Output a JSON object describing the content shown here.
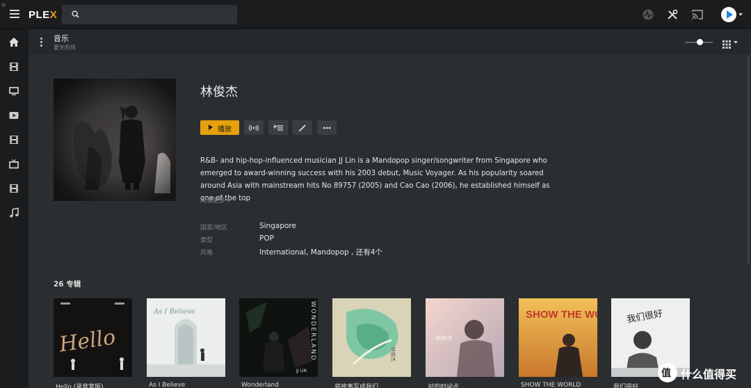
{
  "app": {
    "logo_main": "PLE",
    "logo_accent": "X"
  },
  "topbar": {
    "icons": [
      "menu-icon",
      "search-icon",
      "activity-icon",
      "settings-tools-icon",
      "cast-icon",
      "avatar-icon"
    ]
  },
  "sidebar": {
    "items": [
      {
        "icon": "home-icon"
      },
      {
        "icon": "film-icon"
      },
      {
        "icon": "monitor-icon"
      },
      {
        "icon": "youtube-play-icon"
      },
      {
        "icon": "film-icon"
      },
      {
        "icon": "tv-icon"
      },
      {
        "icon": "film-icon"
      },
      {
        "icon": "music-note-icon"
      }
    ]
  },
  "subheader": {
    "title": "音乐",
    "breadcrumb": "夏天的风"
  },
  "artist": {
    "name": "林俊杰",
    "play_label": "播放",
    "rating": "· · · · ·",
    "summary": "R&B- and hip-hop-influenced musician JJ Lin is a Mandopop singer/songwriter from Singapore who emerged to award-winning success with his 2003 debut, Music Voyager. As his popularity soared around Asia with mainstream hits No 89757 (2005) and Cao Cao (2006), he established himself as one of the top",
    "read_more": "阅读更多",
    "meta": [
      {
        "label": "国家/地区",
        "value": "Singapore"
      },
      {
        "label": "类型",
        "value": "POP"
      },
      {
        "label": "风格",
        "value": "International, Mandopop , 还有4个"
      }
    ]
  },
  "albums": {
    "header": "26 专辑",
    "items": [
      {
        "title": "Hello (录音室版)",
        "cover_text": "Hello"
      },
      {
        "title": "As I Believe",
        "cover_text": "As I Believe"
      },
      {
        "title": "Wonderland",
        "cover_text": "WONDERLAND",
        "cover_sub": "JJ LIN"
      },
      {
        "title": "将故事写成我们",
        "cover_text": "林俊杰"
      },
      {
        "title": "对的时间点",
        "cover_text": "林俊杰"
      },
      {
        "title": "SHOW THE WORLD",
        "cover_text": "SHOW THE WORLD"
      },
      {
        "title": "我们很好",
        "cover_text": "我们很好"
      }
    ]
  },
  "watermark": {
    "badge": "值",
    "text": "什么值得买"
  },
  "colors": {
    "accent": "#e5a00d",
    "background": "#2a2e31",
    "topbar": "#1a1c1e"
  }
}
